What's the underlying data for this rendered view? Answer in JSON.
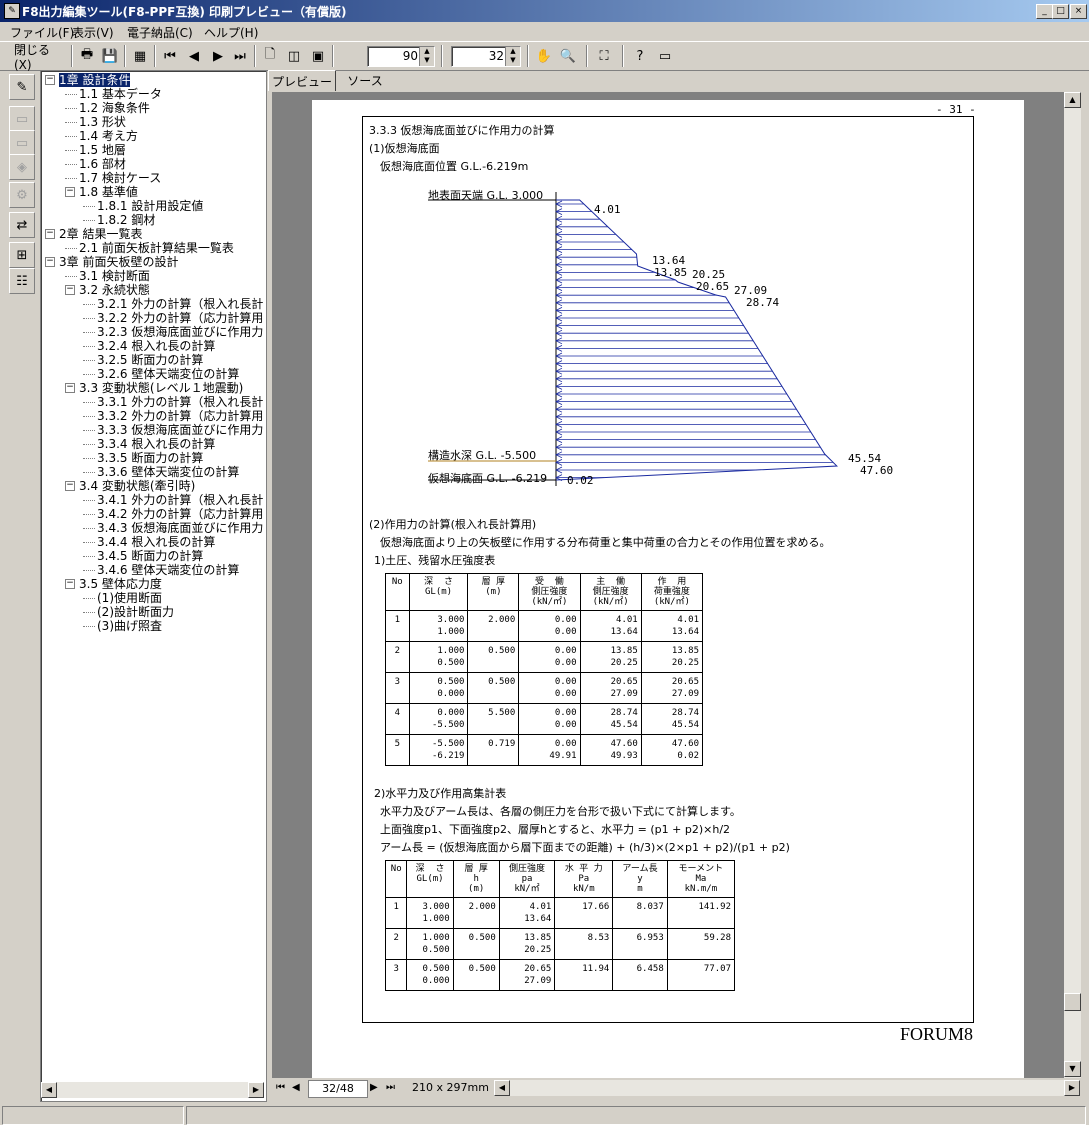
{
  "window": {
    "title": "F8出力編集ツール(F8-PPF互換) 印刷プレビュー（有償版)",
    "min": "_",
    "max": "□",
    "close": "×"
  },
  "menu": [
    "ファイル(F)",
    "表示(V)",
    "電子納品(C)",
    "ヘルプ(H)"
  ],
  "toolbar": {
    "close_label": "閉じる(X)",
    "zoom_value": "90",
    "page_value": "32"
  },
  "tabs": [
    "プレビュー",
    "ソース"
  ],
  "tree": [
    {
      "label": "1章 設計条件",
      "level": 0,
      "box": "−",
      "selected": true
    },
    {
      "label": "1.1 基本データ",
      "level": 1
    },
    {
      "label": "1.2 海象条件",
      "level": 1
    },
    {
      "label": "1.3 形状",
      "level": 1
    },
    {
      "label": "1.4 考え方",
      "level": 1
    },
    {
      "label": "1.5 地層",
      "level": 1
    },
    {
      "label": "1.6 部材",
      "level": 1
    },
    {
      "label": "1.7 検討ケース",
      "level": 1
    },
    {
      "label": "1.8 基準値",
      "level": 1,
      "box": "−"
    },
    {
      "label": "1.8.1 設計用設定値",
      "level": 2
    },
    {
      "label": "1.8.2 鋼材",
      "level": 2
    },
    {
      "label": "2章 結果一覧表",
      "level": 0,
      "box": "−"
    },
    {
      "label": "2.1 前面矢板計算結果一覧表",
      "level": 1
    },
    {
      "label": "3章 前面矢板壁の設計",
      "level": 0,
      "box": "−"
    },
    {
      "label": "3.1 検討断面",
      "level": 1
    },
    {
      "label": "3.2 永続状態",
      "level": 1,
      "box": "−"
    },
    {
      "label": "3.2.1 外力の計算（根入れ長計",
      "level": 2
    },
    {
      "label": "3.2.2 外力の計算（応力計算用",
      "level": 2
    },
    {
      "label": "3.2.3 仮想海底面並びに作用力",
      "level": 2
    },
    {
      "label": "3.2.4 根入れ長の計算",
      "level": 2
    },
    {
      "label": "3.2.5 断面力の計算",
      "level": 2
    },
    {
      "label": "3.2.6 壁体天端変位の計算",
      "level": 2
    },
    {
      "label": "3.3 変動状態(レベル１地震動)",
      "level": 1,
      "box": "−"
    },
    {
      "label": "3.3.1 外力の計算（根入れ長計",
      "level": 2
    },
    {
      "label": "3.3.2 外力の計算（応力計算用",
      "level": 2
    },
    {
      "label": "3.3.3 仮想海底面並びに作用力",
      "level": 2
    },
    {
      "label": "3.3.4 根入れ長の計算",
      "level": 2
    },
    {
      "label": "3.3.5 断面力の計算",
      "level": 2
    },
    {
      "label": "3.3.6 壁体天端変位の計算",
      "level": 2
    },
    {
      "label": "3.4 変動状態(牽引時)",
      "level": 1,
      "box": "−"
    },
    {
      "label": "3.4.1 外力の計算（根入れ長計",
      "level": 2
    },
    {
      "label": "3.4.2 外力の計算（応力計算用",
      "level": 2
    },
    {
      "label": "3.4.3 仮想海底面並びに作用力",
      "level": 2
    },
    {
      "label": "3.4.4 根入れ長の計算",
      "level": 2
    },
    {
      "label": "3.4.5 断面力の計算",
      "level": 2
    },
    {
      "label": "3.4.6 壁体天端変位の計算",
      "level": 2
    },
    {
      "label": "3.5 壁体応力度",
      "level": 1,
      "box": "−"
    },
    {
      "label": "(1)使用断面",
      "level": 2
    },
    {
      "label": "(2)設計断面力",
      "level": 2
    },
    {
      "label": "(3)曲げ照査",
      "level": 2
    }
  ],
  "nav": {
    "page_indicator": "32/48",
    "paper_size": "210 x 297mm"
  },
  "page": {
    "page_number": "- 31 -",
    "heading": "3.3.3 仮想海底面並びに作用力の計算",
    "sub1": "(1)仮想海底面",
    "virtual_line": "仮想海底面位置  G.L.-6.219m",
    "diagram": {
      "label_top": "地表面天端 G.L.  3.000",
      "label_water": "構造水深  G.L. -5.500",
      "label_bottom": "仮想海底面 G.L. -6.219",
      "values": [
        "4.01",
        "13.64",
        "13.85",
        "20.25",
        "20.65",
        "27.09",
        "28.74",
        "45.54",
        "47.60",
        "0.02"
      ]
    },
    "sub2": "(2)作用力の計算(根入れ長計算用)",
    "sub2_desc": "仮想海底面より上の矢板壁に作用する分布荷重と集中荷重の合力とその作用位置を求める。",
    "t1_title": "1)土圧、残留水圧強度表",
    "t1_headers": [
      "No",
      "深  さ\nGL(m)",
      "層 厚\n(m)",
      "受  働\n側圧強度\n(kN/㎡)",
      "主  働\n側圧強度\n(kN/㎡)",
      "作  用\n荷重強度\n(kN/㎡)"
    ],
    "t1_rows": [
      [
        "1",
        "3.000\n1.000",
        "2.000",
        "0.00\n0.00",
        "4.01\n13.64",
        "4.01\n13.64"
      ],
      [
        "2",
        "1.000\n0.500",
        "0.500",
        "0.00\n0.00",
        "13.85\n20.25",
        "13.85\n20.25"
      ],
      [
        "3",
        "0.500\n0.000",
        "0.500",
        "0.00\n0.00",
        "20.65\n27.09",
        "20.65\n27.09"
      ],
      [
        "4",
        "0.000\n-5.500",
        "5.500",
        "0.00\n0.00",
        "28.74\n45.54",
        "28.74\n45.54"
      ],
      [
        "5",
        "-5.500\n-6.219",
        "0.719",
        "0.00\n49.91",
        "47.60\n49.93",
        "47.60\n0.02"
      ]
    ],
    "t2_title": "2)水平力及び作用高集計表",
    "t2_line1": "水平力及びアーム長は、各層の側圧力を台形で扱い下式にて計算します。",
    "t2_line2": "上面強度p1、下面強度p2、層厚hとすると、水平力 = (p1 + p2)×h/2",
    "t2_line3": "アーム長 = (仮想海底面から層下面までの距離) + (h/3)×(2×p1 + p2)/(p1 + p2)",
    "t2_headers": [
      "No",
      "深  さ\nGL(m)",
      "層 厚\nh\n(m)",
      "側圧強度\npa\nkN/㎡",
      "水 平 力\nPa\nkN/m",
      "アーム長\ny\nm",
      "モーメント\nMa\nkN.m/m"
    ],
    "t2_rows": [
      [
        "1",
        "3.000\n1.000",
        "2.000",
        "4.01\n13.64",
        "17.66",
        "8.037",
        "141.92"
      ],
      [
        "2",
        "1.000\n0.500",
        "0.500",
        "13.85\n20.25",
        "8.53",
        "6.953",
        "59.28"
      ],
      [
        "3",
        "0.500\n0.000",
        "0.500",
        "20.65\n27.09",
        "11.94",
        "6.458",
        "77.07"
      ]
    ],
    "footer_logo": "FORUM8"
  }
}
